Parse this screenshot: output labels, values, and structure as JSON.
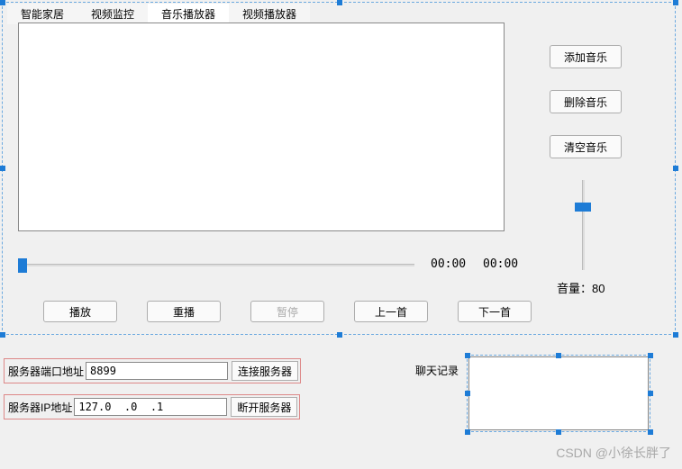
{
  "tabs": {
    "items": [
      {
        "label": "智能家居"
      },
      {
        "label": "视频监控"
      },
      {
        "label": "音乐播放器"
      },
      {
        "label": "视频播放器"
      }
    ],
    "activeIndex": 2
  },
  "sideButtons": {
    "add": "添加音乐",
    "remove": "删除音乐",
    "clear": "清空音乐"
  },
  "time": {
    "current": "00:00",
    "total": "00:00"
  },
  "volume": {
    "label": "音量：",
    "value": "80"
  },
  "controls": {
    "play": "播放",
    "replay": "重播",
    "pause": "暂停",
    "prev": "上一首",
    "next": "下一首"
  },
  "server": {
    "portLabel": "服务器端口地址",
    "portValue": "8899",
    "connectBtn": "连接服务器",
    "ipLabel": "服务器IP地址",
    "ipValue": "127.0  .0  .1",
    "disconnectBtn": "断开服务器"
  },
  "chat": {
    "label": "聊天记录"
  },
  "watermark": "CSDN @小徐长胖了"
}
